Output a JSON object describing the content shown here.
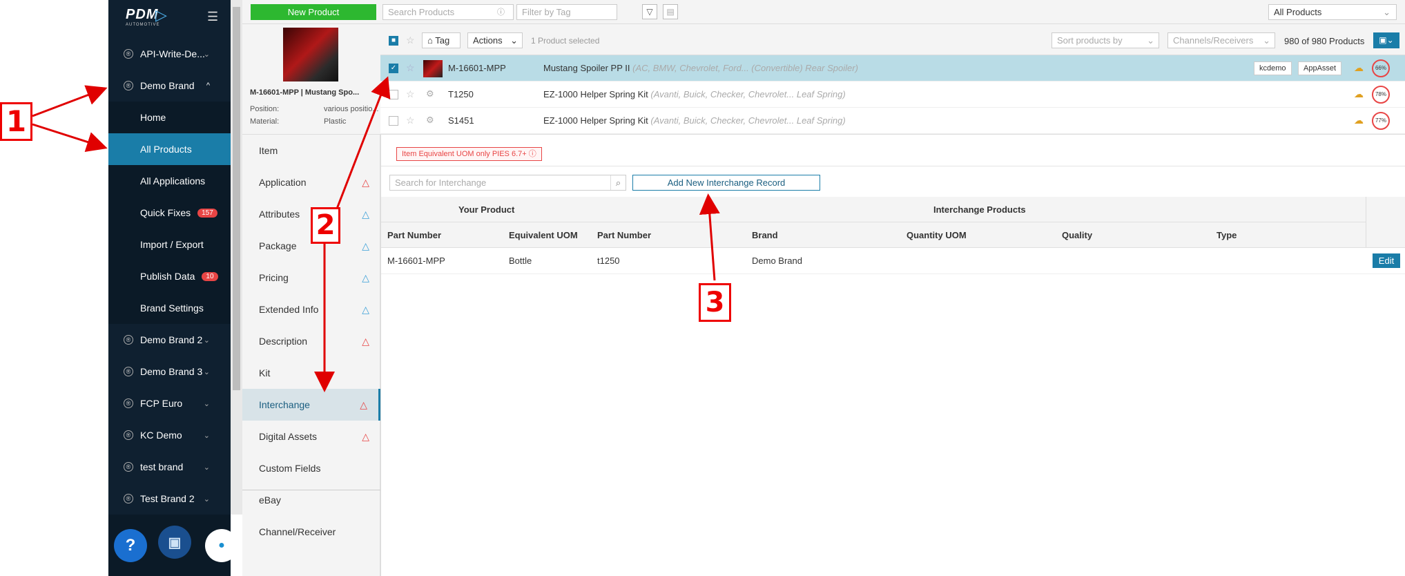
{
  "sidebar": {
    "logo": "PDM",
    "logo_sub": "AUTOMOTIVE",
    "items": [
      {
        "label": "API-Write-De...",
        "chevron": "⌄"
      },
      {
        "label": "Demo Brand",
        "chevron": "^"
      },
      {
        "label": "Home"
      },
      {
        "label": "All Products"
      },
      {
        "label": "All Applications"
      },
      {
        "label": "Quick Fixes",
        "badge": "157"
      },
      {
        "label": "Import / Export"
      },
      {
        "label": "Publish Data",
        "badge": "10"
      },
      {
        "label": "Brand Settings"
      },
      {
        "label": "Demo Brand 2",
        "chevron": "⌄"
      },
      {
        "label": "Demo Brand 3",
        "chevron": "⌄"
      },
      {
        "label": "FCP Euro",
        "chevron": "⌄"
      },
      {
        "label": "KC Demo",
        "chevron": "⌄"
      },
      {
        "label": "test brand",
        "chevron": "⌄"
      },
      {
        "label": "Test Brand 2",
        "chevron": "⌄"
      }
    ],
    "reg_symbol": "®",
    "help_label": "?"
  },
  "topbar": {
    "new_product": "New Product",
    "search_placeholder": "Search Products",
    "filter_placeholder": "Filter by Tag",
    "scope": "All Products"
  },
  "product_card": {
    "title": "M-16601-MPP | Mustang Spo...",
    "position_label": "Position:",
    "position_value": "various positio...",
    "material_label": "Material:",
    "material_value": "Plastic"
  },
  "nav": {
    "items": [
      {
        "label": "Item",
        "warn": ""
      },
      {
        "label": "Application",
        "warn": "red"
      },
      {
        "label": "Attributes",
        "warn": "blue"
      },
      {
        "label": "Package",
        "warn": "blue"
      },
      {
        "label": "Pricing",
        "warn": "blue"
      },
      {
        "label": "Extended Info",
        "warn": "blue"
      },
      {
        "label": "Description",
        "warn": "red"
      },
      {
        "label": "Kit",
        "warn": ""
      },
      {
        "label": "Interchange",
        "warn": "red"
      },
      {
        "label": "Digital Assets",
        "warn": "red"
      },
      {
        "label": "Custom Fields",
        "warn": ""
      },
      {
        "label": "eBay",
        "warn": ""
      },
      {
        "label": "Channel/Receiver",
        "warn": ""
      }
    ]
  },
  "list": {
    "tag_label": "Tag",
    "actions_label": "Actions",
    "selected_text": "1 Product selected",
    "sort_placeholder": "Sort products by",
    "channels_placeholder": "Channels/Receivers",
    "count": "980 of 980 Products",
    "rows": [
      {
        "pn": "M-16601-MPP",
        "name": "Mustang Spoiler PP II",
        "fitment": "(AC, BMW, Chevrolet, Ford... (Convertible) Rear Spoiler)",
        "tags": [
          "kcdemo",
          "AppAsset"
        ],
        "pct": "66%"
      },
      {
        "pn": "T1250",
        "name": "EZ-1000 Helper Spring Kit",
        "fitment": "(Avanti, Buick, Checker, Chevrolet... Leaf Spring)",
        "pct": "78%"
      },
      {
        "pn": "S1451",
        "name": "EZ-1000 Helper Spring Kit",
        "fitment": "(Avanti, Buick, Checker, Chevrolet... Leaf Spring)",
        "pct": "77%"
      }
    ]
  },
  "interchange": {
    "warning": "Item Equivalent UOM only PIES 6.7+",
    "search_placeholder": "Search for Interchange",
    "add_button": "Add New Interchange Record",
    "group_your": "Your Product",
    "group_interchange": "Interchange Products",
    "columns": [
      "Part Number",
      "Equivalent UOM",
      "Part Number",
      "Brand",
      "Quantity UOM",
      "Quality",
      "Type"
    ],
    "row": {
      "part_number": "M-16601-MPP",
      "uom": "Bottle",
      "ic_part": "t1250",
      "brand": "Demo Brand",
      "qty_uom": "",
      "quality": "",
      "type": ""
    },
    "edit_label": "Edit"
  },
  "annotations": {
    "one": "1",
    "two": "2",
    "three": "3",
    "color": "#e00000"
  }
}
